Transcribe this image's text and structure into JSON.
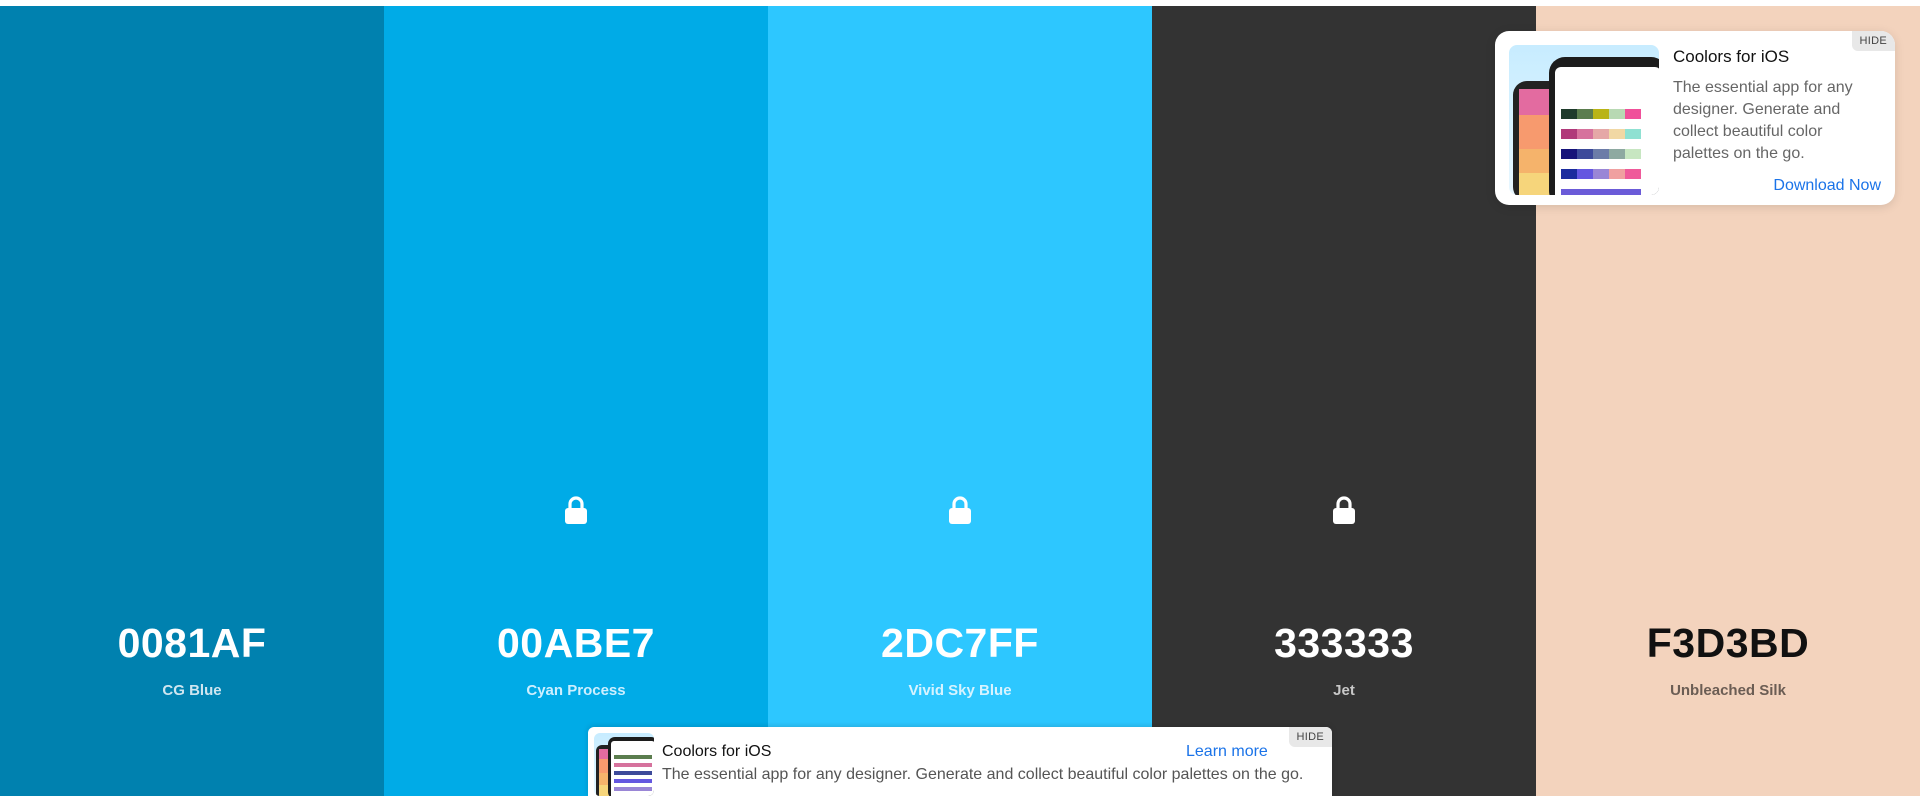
{
  "palette": [
    {
      "hex": "0081AF",
      "name": "CG Blue",
      "bg": "#0081AF",
      "text_color": "#ffffff",
      "name_color": "#cfe6f0",
      "locked": false
    },
    {
      "hex": "00ABE7",
      "name": "Cyan Process",
      "bg": "#00ABE7",
      "text_color": "#ffffff",
      "name_color": "#cdefff",
      "locked": true
    },
    {
      "hex": "2DC7FF",
      "name": "Vivid Sky Blue",
      "bg": "#2DC7FF",
      "text_color": "#ffffff",
      "name_color": "#d6f3ff",
      "locked": true
    },
    {
      "hex": "333333",
      "name": "Jet",
      "bg": "#333333",
      "text_color": "#ffffff",
      "name_color": "#c8c8c8",
      "locked": true
    },
    {
      "hex": "F3D3BD",
      "name": "Unbleached Silk",
      "bg": "#F3D3BD",
      "text_color": "#111111",
      "name_color": "#6b5d54",
      "locked": false
    }
  ],
  "ad_card": {
    "title": "Coolors for iOS",
    "description": "The essential app for any designer. Generate and collect beautiful color palettes on the go.",
    "cta": "Download Now",
    "hide": "HIDE"
  },
  "ad_banner": {
    "title": "Coolors for iOS",
    "description": "The essential app for any designer. Generate and collect beautiful color palettes on the go.",
    "cta": "Learn more",
    "hide": "HIDE"
  },
  "icons": {
    "lock": "lock-icon"
  }
}
